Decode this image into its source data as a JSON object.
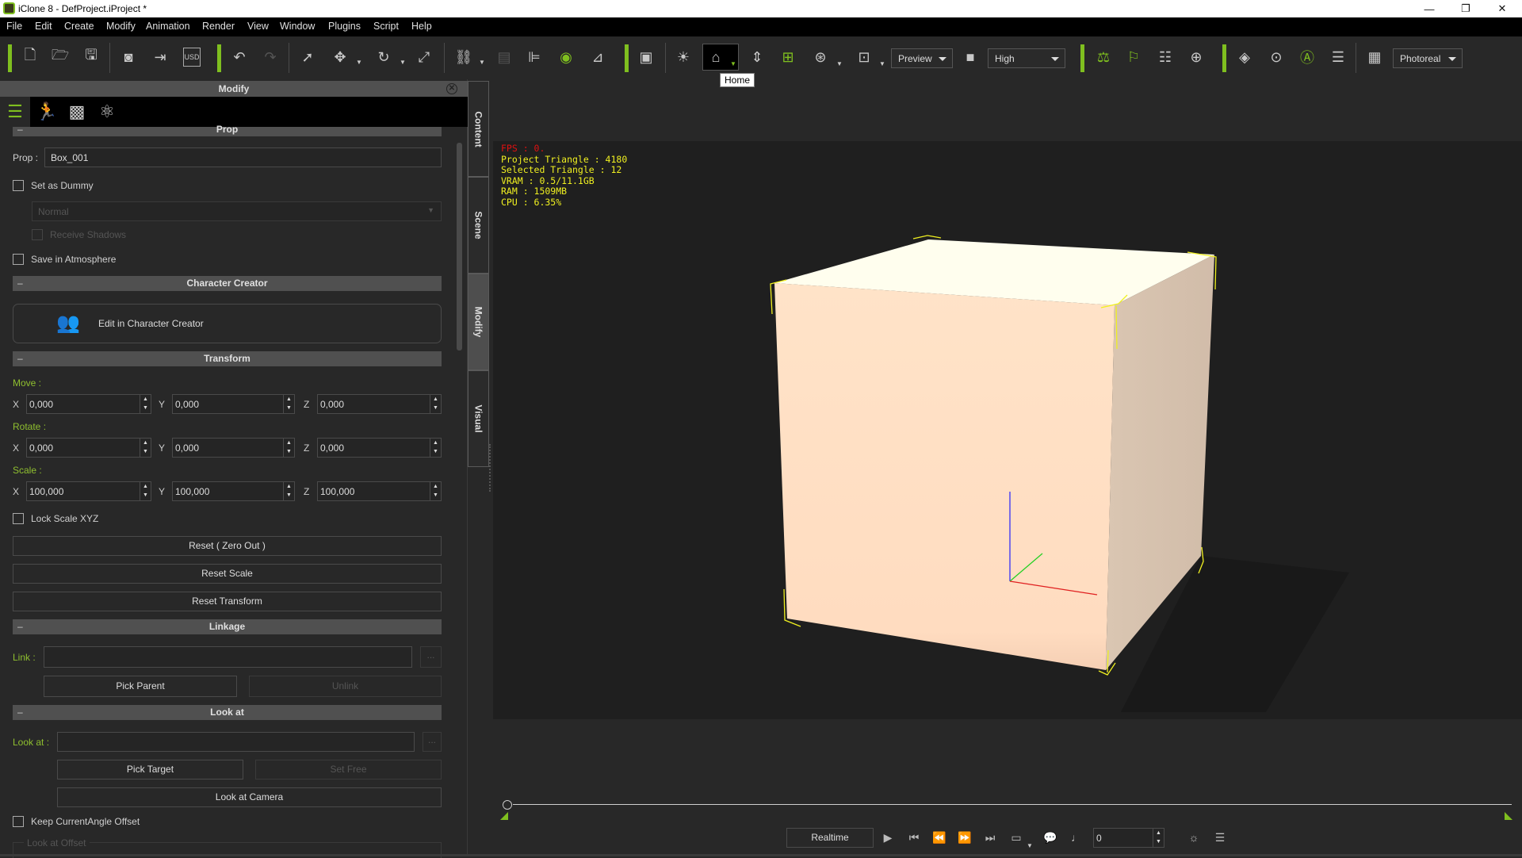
{
  "window": {
    "title": "iClone 8 - DefProject.iProject *",
    "controls": {
      "minimize": "—",
      "restore": "❐",
      "close": "✕"
    }
  },
  "menu": [
    "File",
    "Edit",
    "Create",
    "Modify",
    "Animation",
    "Render",
    "View",
    "Window",
    "Plugins",
    "Script",
    "Help"
  ],
  "toolbar": {
    "icons": {
      "new": "new-file-icon",
      "open": "open-folder-icon",
      "save": "save-icon",
      "preview": "preview-icon",
      "export": "export-icon",
      "usd": "usd-export-icon",
      "undo": "undo-icon",
      "redo": "redo-icon",
      "select": "select-arrow-icon",
      "move": "move-icon",
      "rotate": "rotate-icon",
      "scale": "scale-icon",
      "link": "link-icon",
      "align": "align-icon",
      "align2": "align-right-icon",
      "visibility": "eye-icon",
      "drop": "drop-to-floor-icon",
      "layout": "layout-icon",
      "light": "light-icon",
      "home": "home-icon",
      "fit": "fit-vertical-icon",
      "fit_selected": "fit-selected-icon",
      "orbit": "orbit-icon",
      "frame": "frame-icon",
      "camera": "camera-icon",
      "physics": "physics-icon",
      "flag": "flag-icon",
      "checklist": "checklist-icon",
      "pivot": "pivot-icon",
      "iray": "iray-render-icon",
      "search_iray": "iray-search-icon",
      "auto": "auto-icon",
      "settings": "render-settings-icon",
      "calendar": "calendar-icon"
    },
    "preview_dropdown": "Preview",
    "quality_dropdown": "High",
    "render_mode_dropdown": "Photoreal",
    "tooltip": "Home",
    "u_label": "USD"
  },
  "panel": {
    "title": "Modify",
    "tabs": [
      "attributes",
      "motion",
      "material",
      "physics"
    ],
    "sections": {
      "prop": {
        "title": "Prop",
        "prop_label": "Prop :",
        "prop_value": "Box_001",
        "set_as_dummy": "Set as Dummy",
        "dummy_mode": "Normal",
        "receive_shadows": "Receive Shadows",
        "save_in_atmosphere": "Save in Atmosphere"
      },
      "character_creator": {
        "title": "Character Creator",
        "edit_button": "Edit in Character Creator"
      },
      "transform": {
        "title": "Transform",
        "move_label": "Move :",
        "rotate_label": "Rotate :",
        "scale_label": "Scale :",
        "axes": [
          "X",
          "Y",
          "Z"
        ],
        "move": [
          "0,000",
          "0,000",
          "0,000"
        ],
        "rotate": [
          "0,000",
          "0,000",
          "0,000"
        ],
        "scale": [
          "100,000",
          "100,000",
          "100,000"
        ],
        "lock_scale": "Lock Scale XYZ",
        "reset_zero": "Reset ( Zero Out )",
        "reset_scale": "Reset Scale",
        "reset_transform": "Reset Transform"
      },
      "linkage": {
        "title": "Linkage",
        "link_label": "Link :",
        "link_value": "",
        "browse": "...",
        "pick_parent": "Pick Parent",
        "unlink": "Unlink"
      },
      "look_at": {
        "title": "Look at",
        "look_at_label": "Look at :",
        "look_at_value": "",
        "browse": "...",
        "pick_target": "Pick Target",
        "set_free": "Set Free",
        "look_at_camera": "Look at Camera",
        "keep_offset": "Keep CurrentAngle Offset",
        "offset_group": "Look at Offset"
      }
    }
  },
  "side_tabs": [
    "Content",
    "Scene",
    "Modify",
    "Visual"
  ],
  "side_tab_active": "Modify",
  "viewport": {
    "stats": {
      "fps": "FPS : 0.",
      "project_triangle": "Project Triangle : 4180",
      "selected_triangle": "Selected Triangle : 12",
      "vram": "VRAM : 0.5/11.1GB",
      "ram": "RAM : 1509MB",
      "cpu": "CPU : 6.35%"
    },
    "object": "Box_001"
  },
  "timeline": {
    "mode_button": "Realtime",
    "frame_value": "0",
    "playhead_fraction": 0.0
  },
  "colors": {
    "accent": "#7fbf1f",
    "panel_bg": "#282828",
    "viewport_bg": "#1f1f1f",
    "stats_yellow": "#f0f020",
    "fps_red": "#e01010"
  }
}
